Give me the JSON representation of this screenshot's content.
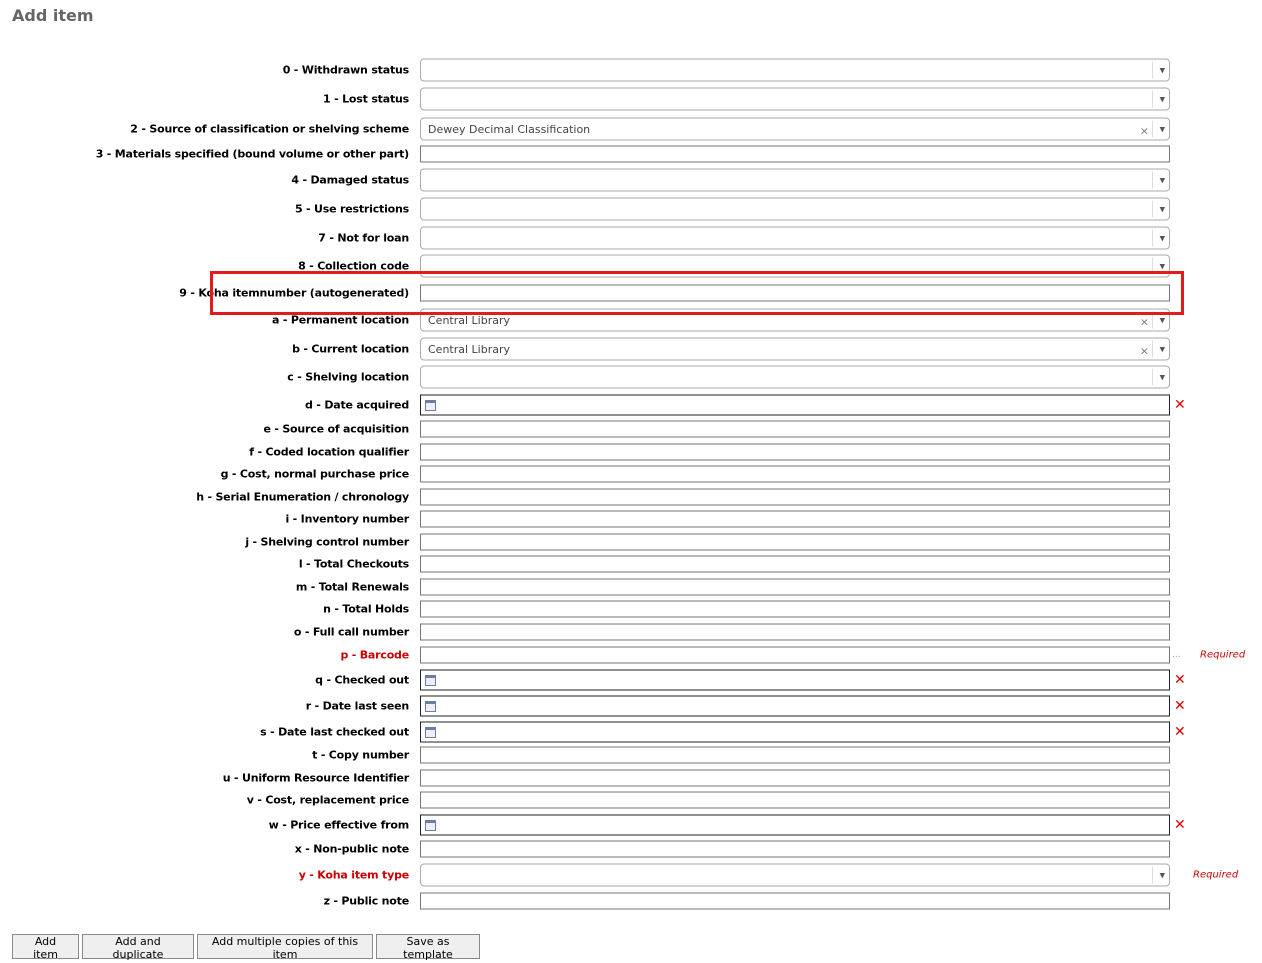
{
  "page_title": "Add item",
  "required_text": "Required",
  "rows": [
    {
      "label": "0 - Withdrawn status",
      "type": "sel"
    },
    {
      "label": "1 - Lost status",
      "type": "sel"
    },
    {
      "label": "2 - Source of classification or shelving scheme",
      "type": "sel",
      "value": "Dewey Decimal Classification",
      "clear": true
    },
    {
      "label": "3 - Materials specified (bound volume or other part)",
      "type": "txt"
    },
    {
      "label": "4 - Damaged status",
      "type": "sel"
    },
    {
      "label": "5 - Use restrictions",
      "type": "sel"
    },
    {
      "label": "7 - Not for loan",
      "type": "sel"
    },
    {
      "label": "8 - Collection code",
      "type": "sel"
    },
    {
      "label": "9 - Koha itemnumber (autogenerated)",
      "type": "txt"
    },
    {
      "label": "a - Permanent location",
      "type": "sel",
      "value": "Central Library",
      "clear": true
    },
    {
      "label": "b - Current location",
      "type": "sel",
      "value": "Central Library",
      "clear": true
    },
    {
      "label": "c - Shelving location",
      "type": "sel"
    },
    {
      "label": "d - Date acquired",
      "type": "date"
    },
    {
      "label": "e - Source of acquisition",
      "type": "txt"
    },
    {
      "label": "f - Coded location qualifier",
      "type": "txt"
    },
    {
      "label": "g - Cost, normal purchase price",
      "type": "txt"
    },
    {
      "label": "h - Serial Enumeration / chronology",
      "type": "txt"
    },
    {
      "label": "i - Inventory number",
      "type": "txt"
    },
    {
      "label": "j - Shelving control number",
      "type": "txt"
    },
    {
      "label": "l - Total Checkouts",
      "type": "txt"
    },
    {
      "label": "m - Total Renewals",
      "type": "txt"
    },
    {
      "label": "n - Total Holds",
      "type": "txt"
    },
    {
      "label": "o - Full call number",
      "type": "txt"
    },
    {
      "label": "p - Barcode",
      "type": "txt",
      "required": true,
      "dots": "..."
    },
    {
      "label": "q - Checked out",
      "type": "date"
    },
    {
      "label": "r - Date last seen",
      "type": "date"
    },
    {
      "label": "s - Date last checked out",
      "type": "date"
    },
    {
      "label": "t - Copy number",
      "type": "txt"
    },
    {
      "label": "u - Uniform Resource Identifier",
      "type": "txt"
    },
    {
      "label": "v - Cost, replacement price",
      "type": "txt"
    },
    {
      "label": "w - Price effective from",
      "type": "date"
    },
    {
      "label": "x - Non-public note",
      "type": "txt"
    },
    {
      "label": "y - Koha item type",
      "type": "sel",
      "required": true
    },
    {
      "label": "z - Public note",
      "type": "txt"
    }
  ],
  "buttons": {
    "add_item": "Add item",
    "add_duplicate": "Add and duplicate",
    "add_multiple": "Add multiple copies of this item",
    "save_template": "Save as template"
  },
  "colors": {
    "required": "#cc0000",
    "highlight": "#e31b1b"
  }
}
